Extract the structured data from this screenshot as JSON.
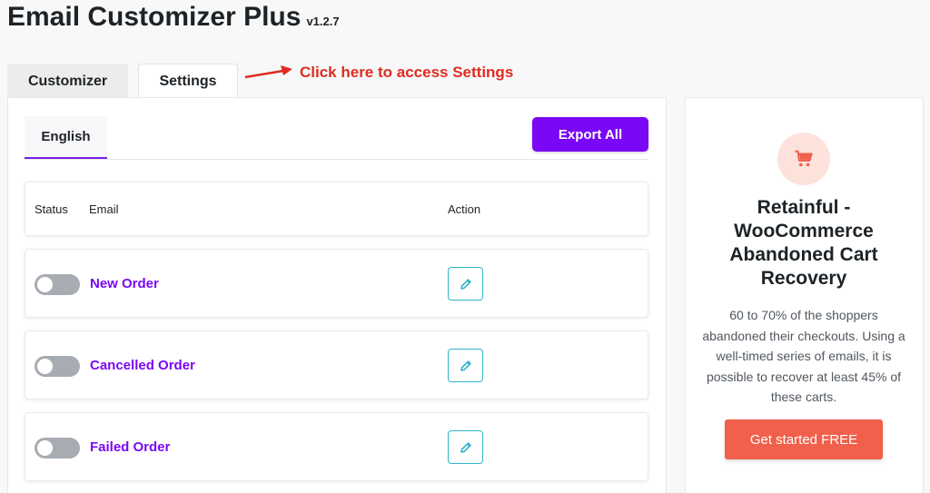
{
  "header": {
    "title": "Email Customizer Plus",
    "version": "v1.2.7"
  },
  "tabs": [
    {
      "label": "Customizer",
      "active": true
    },
    {
      "label": "Settings",
      "active": false
    }
  ],
  "annotation": {
    "text": "Click here to access Settings"
  },
  "language_tabs": [
    {
      "label": "English",
      "active": true
    }
  ],
  "export_button": {
    "label": "Export All"
  },
  "table": {
    "columns": {
      "status": "Status",
      "email": "Email",
      "action": "Action"
    },
    "rows": [
      {
        "name": "New Order",
        "enabled": false,
        "action_icon": "pencil-icon"
      },
      {
        "name": "Cancelled Order",
        "enabled": false,
        "action_icon": "pencil-icon"
      },
      {
        "name": "Failed Order",
        "enabled": false,
        "action_icon": "pencil-icon"
      }
    ]
  },
  "promo": {
    "icon": "shopping-cart-icon",
    "title": "Retainful - WooCommerce Abandoned Cart Recovery",
    "description": "60 to 70% of the shoppers abandoned their checkouts. Using a well-timed series of emails, it is possible to recover at least 45% of these carts.",
    "button_label": "Get started FREE"
  },
  "colors": {
    "accent": "#7a07f5",
    "annotation": "#e02b20",
    "promo_button": "#f1604a",
    "edit_border": "#33b4c6",
    "toggle_off": "#a7acb3"
  }
}
